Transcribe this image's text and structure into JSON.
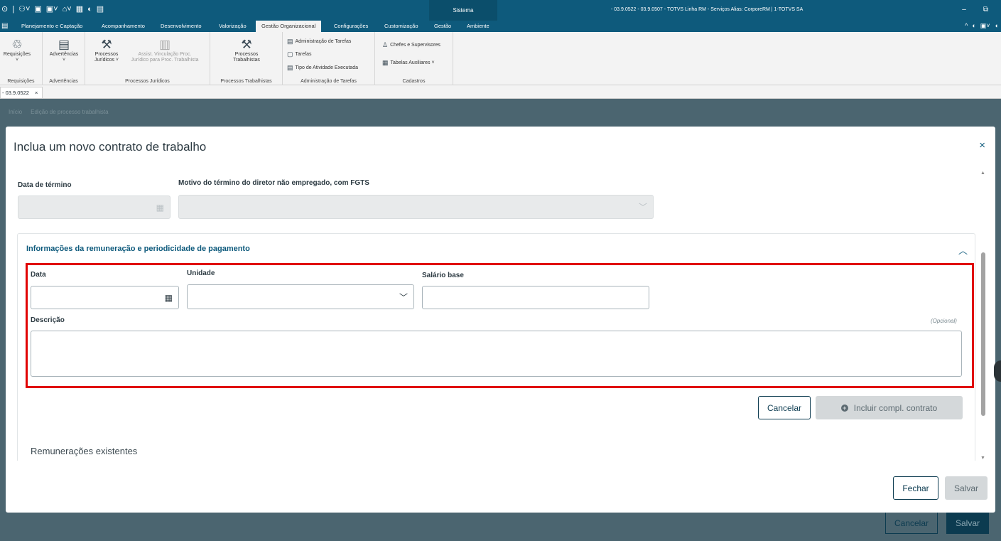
{
  "titlebar": {
    "sistema": "Sistema",
    "window_title": "- 03.9.0522 - 03.9.0507 - TOTVS Linha RM - Serviços  Alias: CorporeRM | 1-TOTVS SA"
  },
  "menu": {
    "items": [
      "Planejamento e Captação",
      "Acompanhamento",
      "Desenvolvimento",
      "Valorização",
      "Gestão Organizacional",
      "Configurações",
      "Customização",
      "Gestão",
      "Ambiente"
    ],
    "active": "Gestão Organizacional"
  },
  "ribbon": {
    "requisicoes": {
      "button": "Requisições",
      "group": "Requisições"
    },
    "advertencias": {
      "button": "Advertências",
      "group": "Advertências"
    },
    "processos_juridicos": {
      "button1_line1": "Processos",
      "button1_line2": "Jurídicos ˅",
      "button2_line1": "Assist. Vinculação Proc.",
      "button2_line2": "Jurídico para Proc. Trabalhista",
      "group": "Processos Jurídicos"
    },
    "processos_trabalhistas": {
      "button_line1": "Processos",
      "button_line2": "Trabalhistas",
      "group": "Processos Trabalhistas"
    },
    "administracao": {
      "items": [
        "Administração de Tarefas",
        "Tarefas",
        "Tipo de Atividade Executada"
      ],
      "group": "Administração de Tarefas"
    },
    "cadastros": {
      "items": [
        "Chefes e Supervisores",
        "Tabelas Auxiliares ˅"
      ],
      "group": "Cadastros"
    }
  },
  "doc_tab": {
    "label": "- 03.9.0522",
    "close": "×"
  },
  "breadcrumb": [
    "Início",
    "Edição de processo trabalhista"
  ],
  "background_buttons": {
    "cancel": "Cancelar",
    "save": "Salvar"
  },
  "modal": {
    "title": "Inclua um novo contrato de trabalho",
    "close": "×",
    "fields": {
      "data_termino_label": "Data de término",
      "motivo_label": "Motivo do término do diretor não empregado, com FGTS"
    },
    "remuneracao": {
      "title": "Informações da remuneração e periodicidade de pagamento",
      "data_label": "Data",
      "unidade_label": "Unidade",
      "salario_label": "Salário base",
      "descricao_label": "Descrição",
      "optional": "(Opcional)",
      "cancel_label": "Cancelar",
      "include_label": "Incluir compl. contrato",
      "existing_title": "Remunerações existentes"
    },
    "footer": {
      "close_label": "Fechar",
      "save_label": "Salvar"
    }
  }
}
